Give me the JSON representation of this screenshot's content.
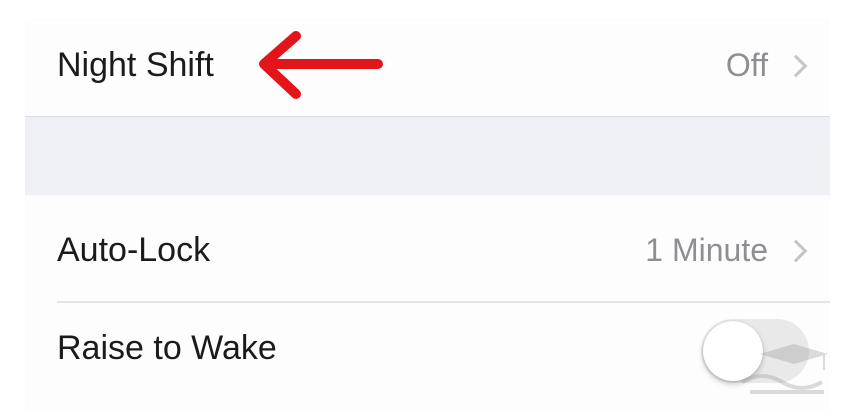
{
  "settings": {
    "night_shift": {
      "label": "Night Shift",
      "value": "Off"
    },
    "auto_lock": {
      "label": "Auto-Lock",
      "value": "1 Minute"
    },
    "raise_to_wake": {
      "label": "Raise to Wake",
      "enabled": false
    }
  },
  "annotation": {
    "arrow_color": "#e3151a",
    "icon": "red-left-arrow"
  },
  "watermark": {
    "icon": "graduation-cap-logo"
  },
  "colors": {
    "background": "#fdfdfd",
    "group_separator": "#eff0f6",
    "secondary_text": "#8e8e93",
    "toggle_off": "#e9e9ea"
  }
}
